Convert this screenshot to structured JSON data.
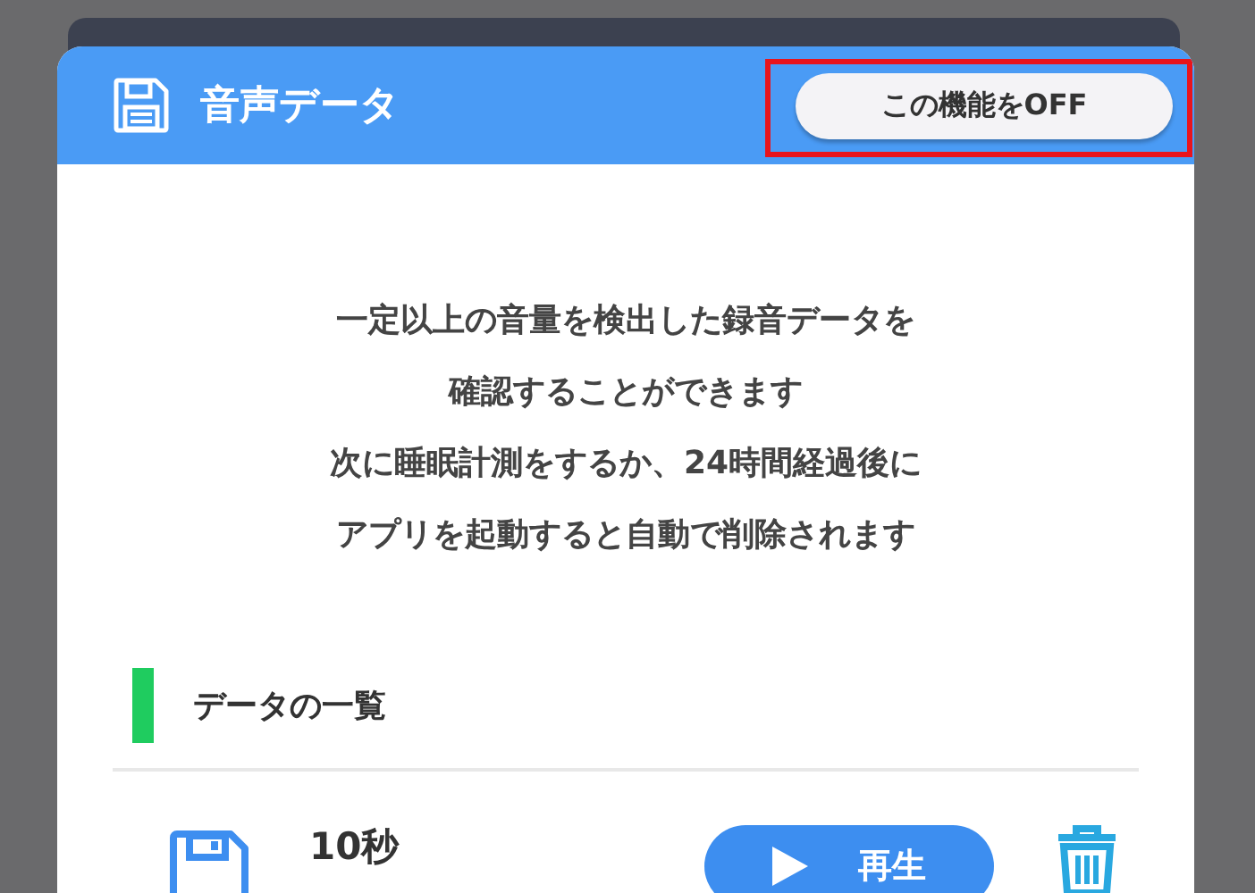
{
  "panel": {
    "title": "音声データ",
    "toggle_button": {
      "label": "この機能をOFF",
      "highlighted": true
    }
  },
  "description": [
    "一定以上の音量を検出した録音データを",
    "確認することができます",
    "次に睡眠計測をするか、24時間経過後に",
    "アプリを起動すると自動で削除されます"
  ],
  "section": {
    "title": "データの一覧"
  },
  "recordings": [
    {
      "duration": "10秒",
      "play_label": "再生"
    }
  ]
}
